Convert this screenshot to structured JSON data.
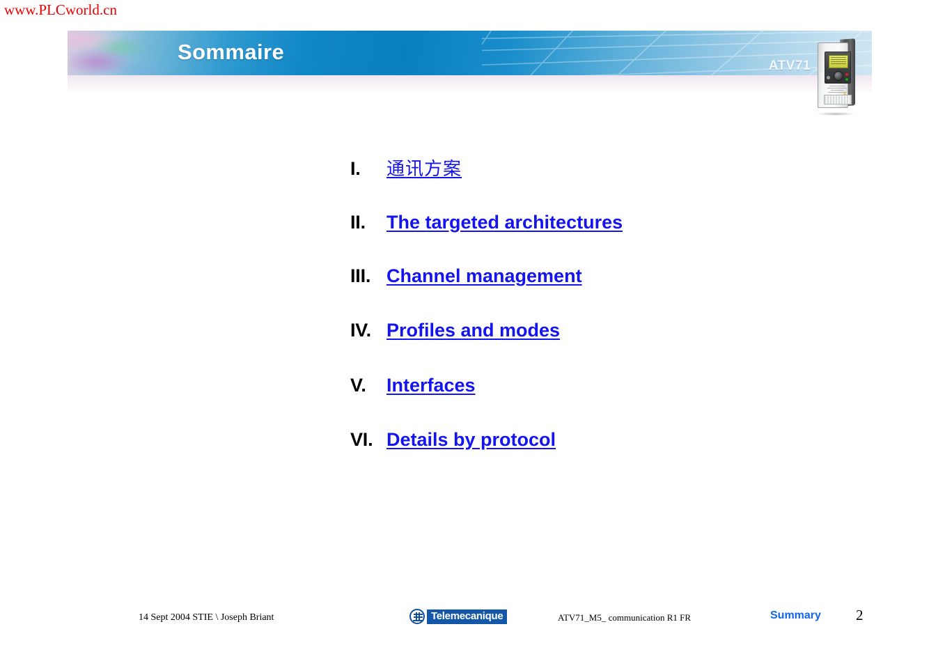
{
  "watermark": {
    "text": "www.PLCworld.cn",
    "color": "#ee0000"
  },
  "banner": {
    "title": "Sommaire",
    "product_label": "ATV71",
    "accent_blue": "#0a7fc0"
  },
  "toc": {
    "items": [
      {
        "numeral": "I.",
        "label": "通讯方案",
        "script": "cjk"
      },
      {
        "numeral": "II.",
        "label": "The targeted architectures",
        "script": "latin"
      },
      {
        "numeral": "III.",
        "label": "Channel management",
        "script": "latin"
      },
      {
        "numeral": "IV.",
        "label": "Profiles and modes",
        "script": "latin"
      },
      {
        "numeral": "V.",
        "label": "Interfaces",
        "script": "latin"
      },
      {
        "numeral": "VI.",
        "label": "Details by protocol",
        "script": "latin"
      }
    ],
    "link_color": "#1414ee"
  },
  "footer": {
    "date_author": "14 Sept 2004   STIE \\ Joseph Briant",
    "logo_word": "Telemecanique",
    "document": "ATV71_M5_ communication R1 FR",
    "section": "Summary",
    "page_number": "2",
    "section_color": "#1165f0"
  }
}
